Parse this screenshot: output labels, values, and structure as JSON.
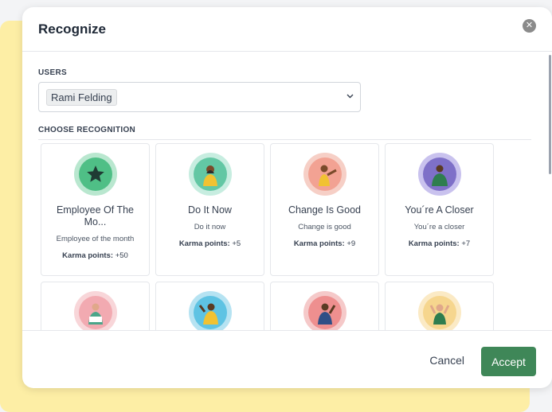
{
  "modal": {
    "title": "Recognize",
    "close_icon": "close-icon"
  },
  "users": {
    "label": "USERS",
    "selected": "Rami Felding",
    "chevron_icon": "chevron-down-icon"
  },
  "recognition": {
    "label": "CHOOSE RECOGNITION",
    "cards": [
      {
        "title": "Employee Of The Mo...",
        "desc": "Employee of the month",
        "karma_label": "Karma points:",
        "karma_value": "+50",
        "ring": "#b9e7cf",
        "inner": "#4fbf86",
        "icon": "star-badge-icon"
      },
      {
        "title": "Do It Now",
        "desc": "Do it now",
        "karma_label": "Karma points:",
        "karma_value": "+5",
        "ring": "#c7ede0",
        "inner": "#63c7a4",
        "icon": "person-badge-icon"
      },
      {
        "title": "Change Is Good",
        "desc": "Change is good",
        "karma_label": "Karma points:",
        "karma_value": "+9",
        "ring": "#f6cfc6",
        "inner": "#f2a293",
        "icon": "person-badge-icon"
      },
      {
        "title": "You´re A Closer",
        "desc": "You´re a closer",
        "karma_label": "Karma points:",
        "karma_value": "+7",
        "ring": "#c9c2ee",
        "inner": "#7e70c8",
        "icon": "person-badge-icon"
      },
      {
        "title": "",
        "desc": "",
        "karma_label": "",
        "karma_value": "",
        "ring": "#f8d6d9",
        "inner": "#f2aab1",
        "icon": "person-badge-icon"
      },
      {
        "title": "",
        "desc": "",
        "karma_label": "",
        "karma_value": "",
        "ring": "#b6e3f2",
        "inner": "#5ec3e3",
        "icon": "person-badge-icon"
      },
      {
        "title": "",
        "desc": "",
        "karma_label": "",
        "karma_value": "",
        "ring": "#f5c9c9",
        "inner": "#ee8f8f",
        "icon": "person-badge-icon"
      },
      {
        "title": "",
        "desc": "",
        "karma_label": "",
        "karma_value": "",
        "ring": "#fbeac5",
        "inner": "#f6d68e",
        "icon": "person-badge-icon"
      }
    ]
  },
  "footer": {
    "cancel_label": "Cancel",
    "accept_label": "Accept"
  }
}
